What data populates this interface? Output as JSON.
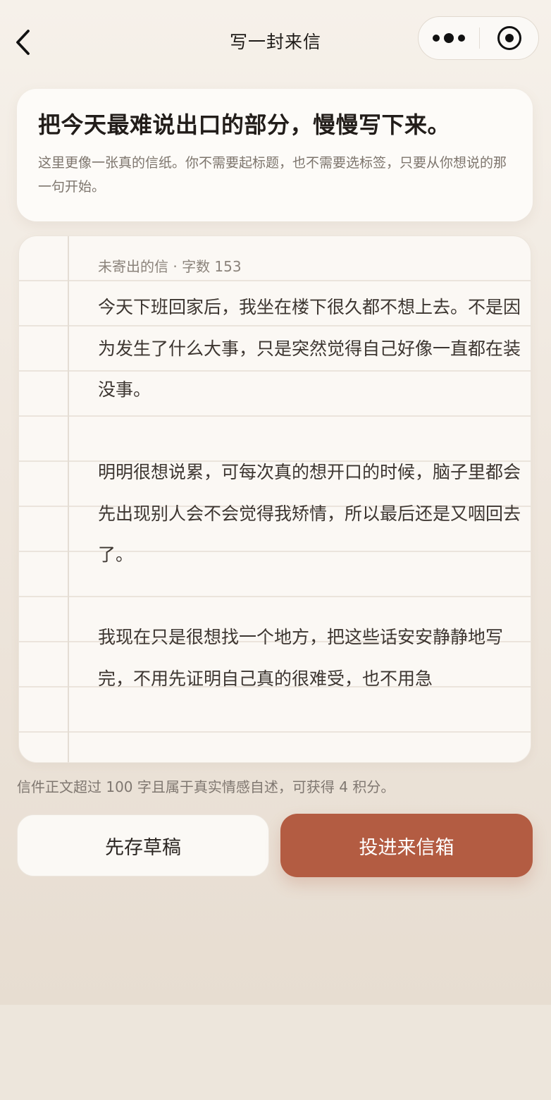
{
  "nav": {
    "title": "写一封来信"
  },
  "intro": {
    "title": "把今天最难说出口的部分，慢慢写下来。",
    "description": "这里更像一张真的信纸。你不需要起标题，也不需要选标签，只要从你想说的那一句开始。"
  },
  "letter": {
    "meta": "未寄出的信 · 字数 153",
    "paragraphs": [
      "今天下班回家后，我坐在楼下很久都不想上去。不是因为发生了什么大事，只是突然觉得自己好像一直都在装没事。",
      "明明很想说累，可每次真的想开口的时候，脑子里都会先出现别人会不会觉得我矫情，所以最后还是又咽回去了。",
      "我现在只是很想找一个地方，把这些话安安静静地写完，不用先证明自己真的很难受，也不用急"
    ]
  },
  "hint": "信件正文超过 100 字且属于真实情感自述，可获得 4 积分。",
  "actions": {
    "draft_label": "先存草稿",
    "submit_label": "投进来信箱"
  },
  "colors": {
    "accent": "#b35c42",
    "background": "#efe7de",
    "card": "#fdfbf8"
  },
  "icons": {
    "back": "chevron-left-icon",
    "more": "more-dots-icon",
    "close": "target-close-icon"
  }
}
